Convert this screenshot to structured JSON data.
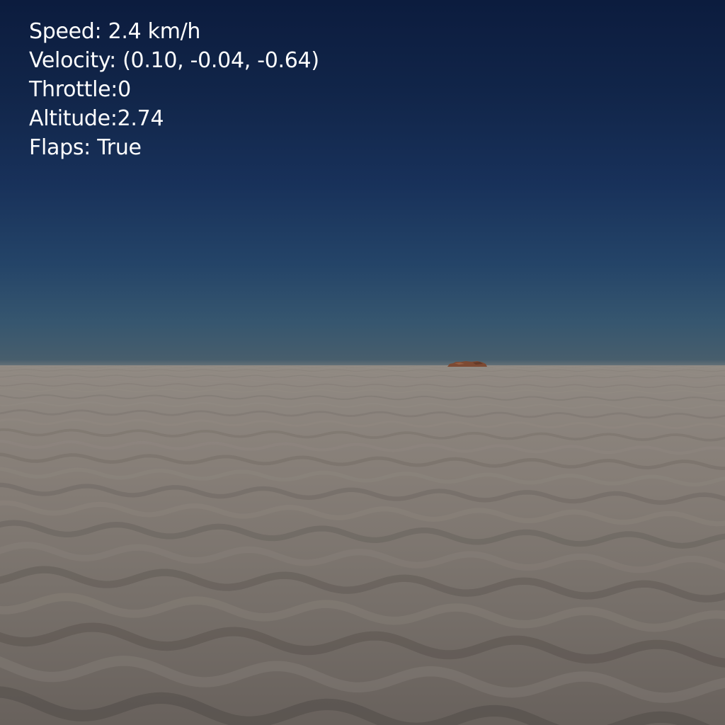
{
  "hud": {
    "speed": "Speed: 2.4 km/h",
    "velocity": "Velocity: (0.10, -0.04, -0.64)",
    "throttle": "Throttle:0",
    "altitude": "Altitude:2.74",
    "flaps": "Flaps: True"
  },
  "colors": {
    "sky_top": "#0c1c3e",
    "sky_horizon": "#4a5f6c",
    "ground_near": "#68615c",
    "ground_far": "#918a83",
    "hud_text": "#ffffff",
    "distant_object": "#8a4a30"
  }
}
